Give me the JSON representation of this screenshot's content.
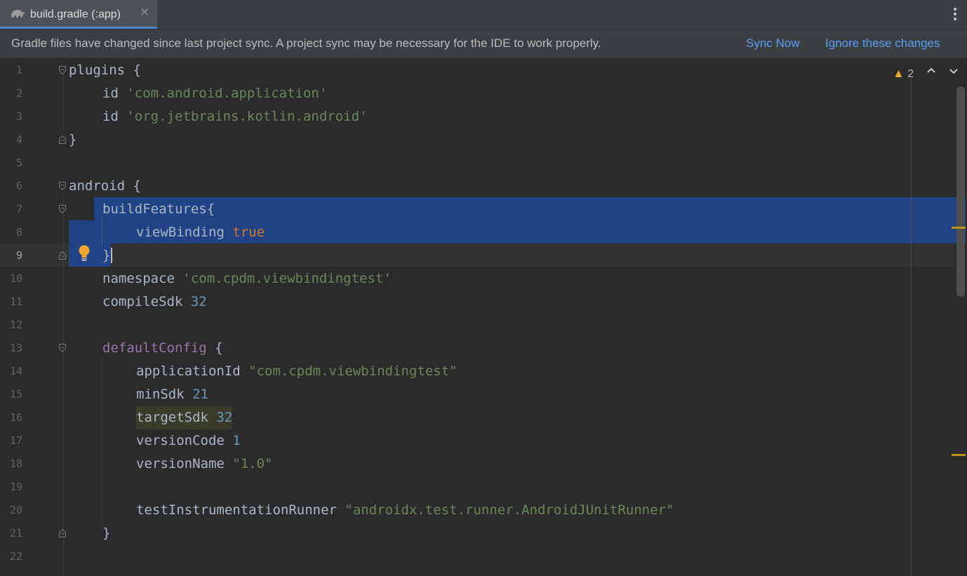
{
  "tab": {
    "title": "build.gradle (:app)",
    "close": "✕"
  },
  "banner": {
    "message": "Gradle files have changed since last project sync. A project sync may be necessary for the IDE to work properly.",
    "sync_now": "Sync Now",
    "ignore": "Ignore these changes"
  },
  "inspection": {
    "warning_count": "2"
  },
  "lines": [
    {
      "n": "1"
    },
    {
      "n": "2"
    },
    {
      "n": "3"
    },
    {
      "n": "4"
    },
    {
      "n": "5"
    },
    {
      "n": "6"
    },
    {
      "n": "7"
    },
    {
      "n": "8"
    },
    {
      "n": "9"
    },
    {
      "n": "10"
    },
    {
      "n": "11"
    },
    {
      "n": "12"
    },
    {
      "n": "13"
    },
    {
      "n": "14"
    },
    {
      "n": "15"
    },
    {
      "n": "16"
    },
    {
      "n": "17"
    },
    {
      "n": "18"
    },
    {
      "n": "19"
    },
    {
      "n": "20"
    },
    {
      "n": "21"
    },
    {
      "n": "22"
    }
  ],
  "code": {
    "l1": "plugins {",
    "l2_kw": "id ",
    "l2_str": "'com.android.application'",
    "l3_kw": "id ",
    "l3_str": "'org.jetbrains.kotlin.android'",
    "l4": "}",
    "l6": "android {",
    "l7": "buildFeatures{",
    "l8_a": "viewBinding ",
    "l8_b": "true",
    "l9": "}",
    "l10_a": "namespace ",
    "l10_b": "'com.cpdm.viewbindingtest'",
    "l11_a": "compileSdk ",
    "l11_b": "32",
    "l13_a": "defaultConfig",
    "l13_b": " {",
    "l14_a": "applicationId ",
    "l14_b": "\"com.cpdm.viewbindingtest\"",
    "l15_a": "minSdk ",
    "l15_b": "21",
    "l16_a": "targetSdk",
    "l16_b": " 32",
    "l17_a": "versionCode ",
    "l17_b": "1",
    "l18_a": "versionName ",
    "l18_b": "\"1.0\"",
    "l20_a": "testInstrumentationRunner ",
    "l20_b": "\"androidx.test.runner.AndroidJUnitRunner\"",
    "l21": "}"
  }
}
